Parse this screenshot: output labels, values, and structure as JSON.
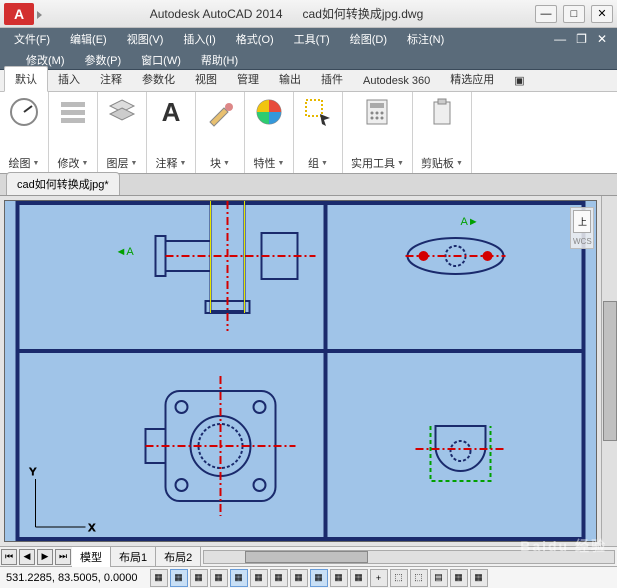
{
  "app": {
    "title": "Autodesk AutoCAD 2014",
    "doc": "cad如何转换成jpg.dwg",
    "logo": "A"
  },
  "window_controls": {
    "min": "—",
    "max": "□",
    "close": "✕"
  },
  "menus": {
    "row1": [
      "文件(F)",
      "编辑(E)",
      "视图(V)",
      "插入(I)",
      "格式(O)",
      "工具(T)",
      "绘图(D)",
      "标注(N)"
    ],
    "row2": [
      "修改(M)",
      "参数(P)",
      "窗口(W)",
      "帮助(H)"
    ]
  },
  "doc_controls": {
    "min": "—",
    "restore": "❐",
    "close": "✕"
  },
  "ribbon": {
    "tabs": [
      "默认",
      "插入",
      "注释",
      "参数化",
      "视图",
      "管理",
      "输出",
      "插件",
      "Autodesk 360",
      "精选应用",
      "▣"
    ],
    "active_tab": 0,
    "panels": [
      {
        "label": "绘图",
        "icon": "gauge"
      },
      {
        "label": "修改",
        "icon": "rows"
      },
      {
        "label": "图层",
        "icon": "layers"
      },
      {
        "label": "注释",
        "icon": "letter-a"
      },
      {
        "label": "块",
        "icon": "brush"
      },
      {
        "label": "特性",
        "icon": "color-wheel"
      },
      {
        "label": "组",
        "icon": "select"
      },
      {
        "label": "实用工具",
        "icon": "calc"
      },
      {
        "label": "剪贴板",
        "icon": "clipboard"
      }
    ]
  },
  "file_tabs": {
    "current": "cad如何转换成jpg*"
  },
  "viewcube": {
    "label": "上",
    "wcs": "WCS"
  },
  "layout_tabs": {
    "nav": [
      "⏮",
      "◀",
      "▶",
      "⏭"
    ],
    "tabs": [
      "模型",
      "布局1",
      "布局2"
    ],
    "active": 0
  },
  "status": {
    "coords": "531.2285, 83.5005, 0.0000",
    "toggles": [
      "▦",
      "▦",
      "▦",
      "▦",
      "▦",
      "▦",
      "▦",
      "▦",
      "▦",
      "▦",
      "▦",
      "+",
      "⬚",
      "⬚",
      "▤",
      "▦",
      "▦"
    ]
  },
  "watermark": "Baidu 经验"
}
